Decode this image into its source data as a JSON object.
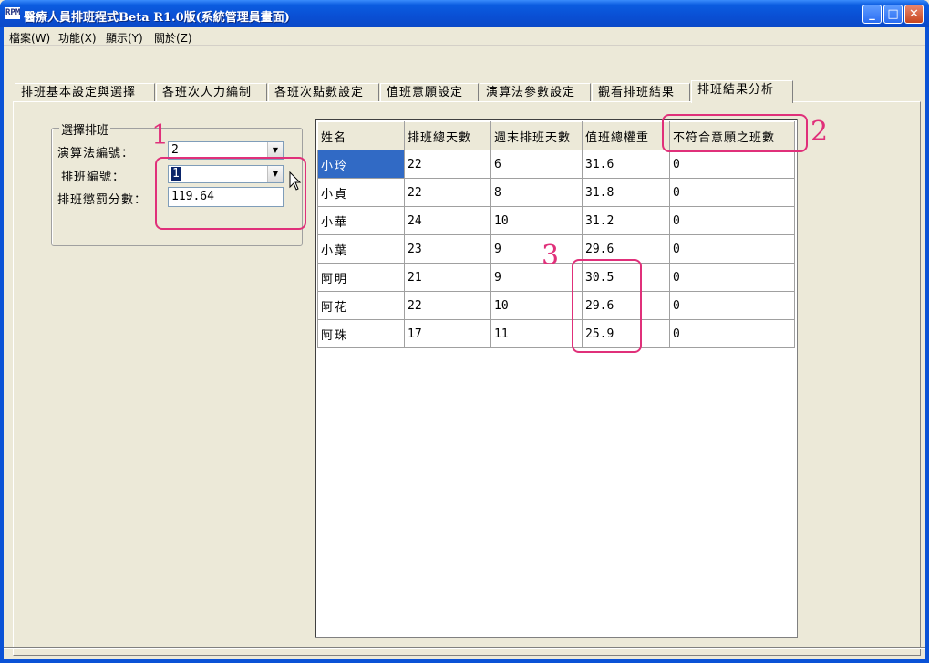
{
  "window": {
    "title": "醫療人員排班程式Beta R1.0版(系統管理員畫面)",
    "icon_text": "RPM"
  },
  "menu": [
    "檔案(W)",
    "功能(X)",
    "顯示(Y)",
    "關於(Z)"
  ],
  "tabs": [
    {
      "label": "排班基本設定與選擇",
      "active": false
    },
    {
      "label": "各班次人力編制",
      "active": false
    },
    {
      "label": "各班次點數設定",
      "active": false
    },
    {
      "label": "值班意願設定",
      "active": false
    },
    {
      "label": "演算法參數設定",
      "active": false
    },
    {
      "label": "觀看排班結果",
      "active": false
    },
    {
      "label": "排班結果分析",
      "active": true
    }
  ],
  "group": {
    "title": "選擇排班",
    "algorithm_label": "演算法編號：",
    "algorithm_value": "2",
    "schedule_label": "排班編號：",
    "schedule_value": "1",
    "penalty_label": "排班懲罰分數：",
    "penalty_value": "119.64"
  },
  "table": {
    "headers": [
      "姓名",
      "排班總天數",
      "週末排班天數",
      "值班總權重",
      "不符合意願之班數"
    ],
    "rows": [
      [
        "小玲",
        "22",
        "6",
        "31.6",
        "0"
      ],
      [
        "小貞",
        "22",
        "8",
        "31.8",
        "0"
      ],
      [
        "小華",
        "24",
        "10",
        "31.2",
        "0"
      ],
      [
        "小葉",
        "23",
        "9",
        "29.6",
        "0"
      ],
      [
        "阿明",
        "21",
        "9",
        "30.5",
        "0"
      ],
      [
        "阿花",
        "22",
        "10",
        "29.6",
        "0"
      ],
      [
        "阿珠",
        "17",
        "11",
        "25.9",
        "0"
      ]
    ]
  },
  "annotations": [
    "1",
    "2",
    "3"
  ],
  "colors": {
    "annotation": "#e0307a",
    "selection": "#316ac5"
  }
}
